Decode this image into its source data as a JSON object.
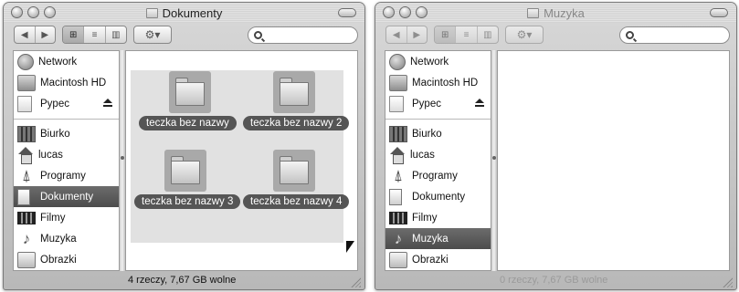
{
  "windows": [
    {
      "title": "Dokumenty",
      "active": true,
      "search": {
        "value": "",
        "placeholder": ""
      },
      "toolbar": {
        "back": "◀",
        "forward": "▶",
        "view_icons": "⊞",
        "view_list": "≡",
        "view_columns": "▥",
        "action": "⚙▾"
      },
      "sidebar": {
        "devices": [
          {
            "label": "Network",
            "icon": "network-globe-icon"
          },
          {
            "label": "Macintosh HD",
            "icon": "hard-drive-icon"
          },
          {
            "label": "Pypec",
            "icon": "document-icon",
            "eject": true
          }
        ],
        "places": [
          {
            "label": "Biurko",
            "icon": "desktop-icon"
          },
          {
            "label": "lucas",
            "icon": "home-icon"
          },
          {
            "label": "Programy",
            "icon": "applications-icon"
          },
          {
            "label": "Dokumenty",
            "icon": "documents-icon",
            "selected": true
          },
          {
            "label": "Filmy",
            "icon": "movies-icon"
          },
          {
            "label": "Muzyka",
            "icon": "music-icon"
          },
          {
            "label": "Obrazki",
            "icon": "pictures-icon"
          }
        ]
      },
      "folders": [
        "teczka bez nazwy",
        "teczka bez nazwy 2",
        "teczka bez nazwy 3",
        "teczka bez nazwy 4"
      ],
      "status": "4 rzeczy, 7,67 GB wolne"
    },
    {
      "title": "Muzyka",
      "active": false,
      "search": {
        "value": "",
        "placeholder": ""
      },
      "toolbar": {
        "back": "◀",
        "forward": "▶",
        "view_icons": "⊞",
        "view_list": "≡",
        "view_columns": "▥",
        "action": "⚙▾"
      },
      "sidebar": {
        "devices": [
          {
            "label": "Network",
            "icon": "network-globe-icon"
          },
          {
            "label": "Macintosh HD",
            "icon": "hard-drive-icon"
          },
          {
            "label": "Pypec",
            "icon": "document-icon",
            "eject": true
          }
        ],
        "places": [
          {
            "label": "Biurko",
            "icon": "desktop-icon"
          },
          {
            "label": "lucas",
            "icon": "home-icon"
          },
          {
            "label": "Programy",
            "icon": "applications-icon"
          },
          {
            "label": "Dokumenty",
            "icon": "documents-icon"
          },
          {
            "label": "Filmy",
            "icon": "movies-icon"
          },
          {
            "label": "Muzyka",
            "icon": "music-icon",
            "selected": true
          },
          {
            "label": "Obrazki",
            "icon": "pictures-icon"
          }
        ]
      },
      "folders": [],
      "status": "0 rzeczy, 7,67 GB wolne"
    }
  ],
  "colors": {
    "selection": "#555555",
    "window_bg": "#c8c8c8",
    "content_bg": "#ffffff",
    "icon_selection_bg": "#e1e1e1"
  }
}
